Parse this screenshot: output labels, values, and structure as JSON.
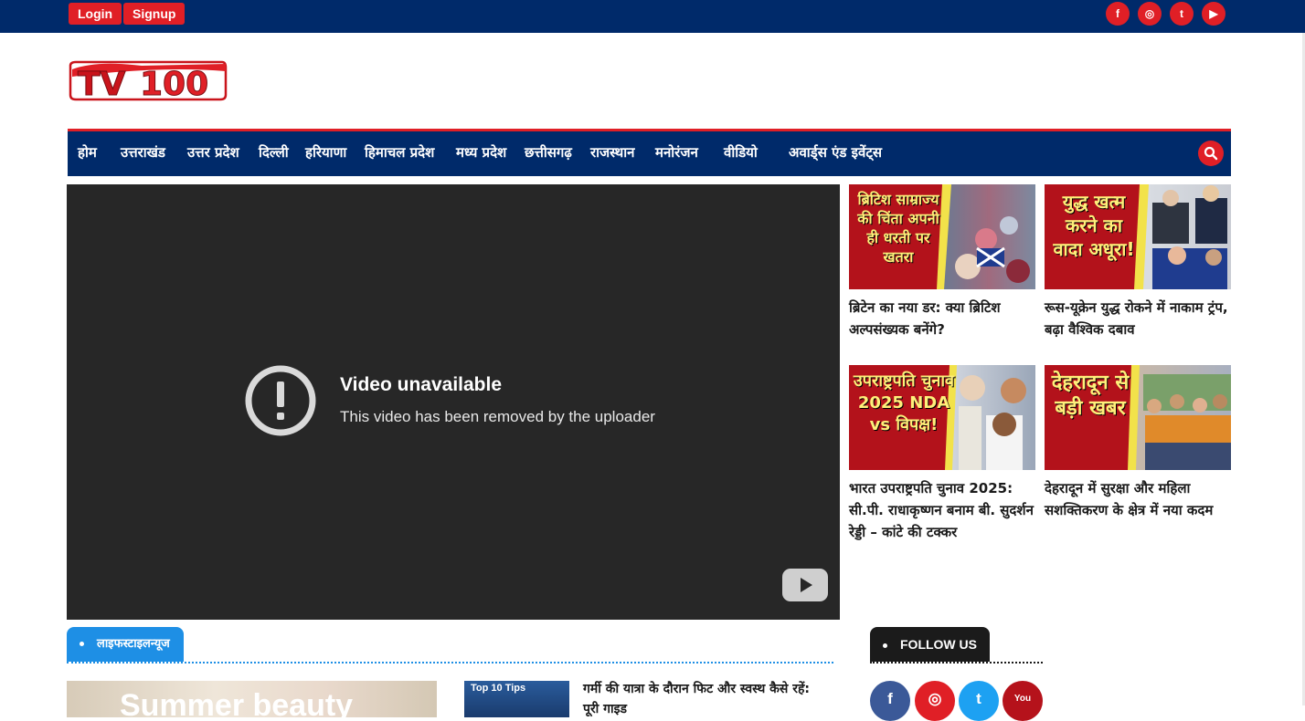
{
  "topbar": {
    "login_label": "Login",
    "signup_label": "Signup",
    "social": [
      {
        "icon": "facebook-icon",
        "glyph": "f"
      },
      {
        "icon": "instagram-icon",
        "glyph": "◎"
      },
      {
        "icon": "twitter-icon",
        "glyph": "t"
      },
      {
        "icon": "youtube-icon",
        "glyph": "▶"
      }
    ]
  },
  "logo": {
    "text_tv": "TV",
    "text_num": "100"
  },
  "nav": {
    "items": [
      "होम",
      "उत्तराखंड",
      "उत्तर प्रदेश",
      "दिल्ली",
      "हरियाणा",
      "हिमाचल प्रदेश",
      "मध्य प्रदेश",
      "छत्तीसगढ़",
      "राजस्थान",
      "मनोरंजन",
      "वीडियो",
      "अवार्ड्स एंड इवेंट्स"
    ]
  },
  "video": {
    "title": "Video unavailable",
    "subtitle": "This video has been removed by the uploader"
  },
  "cards": [
    {
      "thumb_text": "ब्रिटिश साम्राज्य की चिंता अपनी ही धरती पर खतरा",
      "title": "ब्रिटेन का नया डर: क्या ब्रिटिश अल्पसंख्यक बनेंगे?"
    },
    {
      "thumb_text": "युद्ध खत्म करने का वादा अधूरा!",
      "title": "रूस-यूक्रेन युद्ध रोकने में नाकाम ट्रंप, बढ़ा वैश्विक दबाव"
    },
    {
      "thumb_text": "उपराष्ट्रपति चुनाव 2025 NDA vs विपक्ष!",
      "title": "भारत उपराष्ट्रपति चुनाव 2025: सी.पी. राधाकृष्णन बनाम बी. सुदर्शन रेड्डी – कांटे की टक्कर"
    },
    {
      "thumb_text": "देहरादून से बड़ी खबर",
      "title": "देहरादून में सुरक्षा और महिला सशक्तिकरण के क्षेत्र में नया कदम"
    }
  ],
  "section": {
    "label": "लाइफस्टाइलन्यूज"
  },
  "follow": {
    "label": "FOLLOW US"
  },
  "follow_social": [
    {
      "icon": "facebook-icon",
      "glyph": "f",
      "color": "#3b5998"
    },
    {
      "icon": "instagram-icon",
      "glyph": "◎",
      "color": "#e01f26"
    },
    {
      "icon": "twitter-icon",
      "glyph": "t",
      "color": "#1da1f2"
    },
    {
      "icon": "youtube-icon",
      "glyph": "You",
      "color": "#b5121b"
    }
  ],
  "bottom": {
    "img1_text": "Summer beauty",
    "img2_text": "Top 10 Tips",
    "article_title": "गर्मी की यात्रा के दौरान फिट और स्वस्थ कैसे रहें: पूरी गाइड"
  },
  "colors": {
    "brand_blue": "#002a6a",
    "brand_red": "#e01f26",
    "section_blue": "#1e8fe5"
  }
}
